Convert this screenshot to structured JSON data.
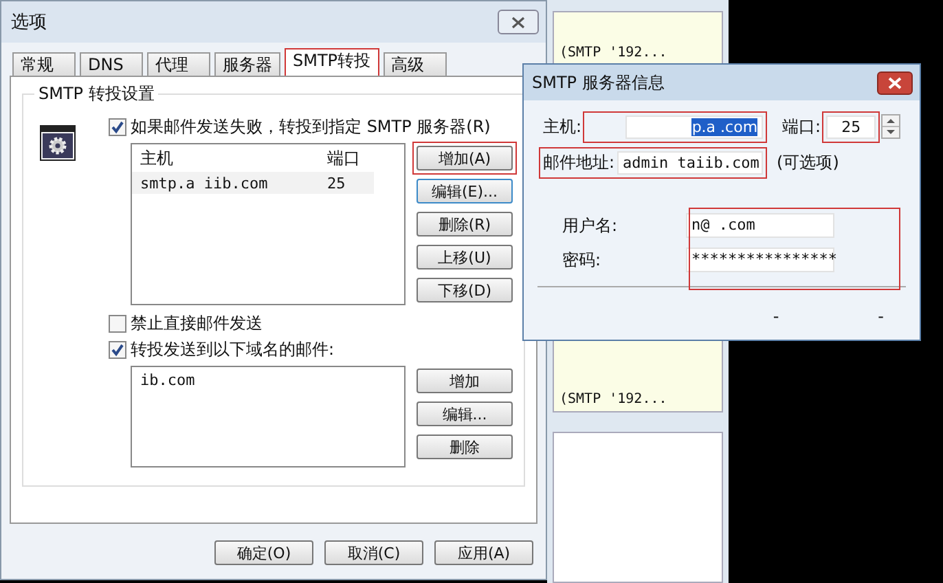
{
  "main_window": {
    "title": "选项",
    "tabs": [
      {
        "label": "常规",
        "selected": false,
        "highlighted": false
      },
      {
        "label": "DNS",
        "selected": false,
        "highlighted": false
      },
      {
        "label": "代理",
        "selected": false,
        "highlighted": false
      },
      {
        "label": "服务器",
        "selected": false,
        "highlighted": false
      },
      {
        "label": "SMTP转投",
        "selected": true,
        "highlighted": true
      },
      {
        "label": "高级",
        "selected": false,
        "highlighted": false
      }
    ],
    "group_title": "SMTP 转投设置",
    "relay_checkbox": {
      "label": "如果邮件发送失败，转投到指定 SMTP 服务器(R)",
      "checked": true
    },
    "server_table": {
      "columns": [
        "主机",
        "端口"
      ],
      "rows": [
        [
          "smtp.a iib.com",
          "25"
        ]
      ]
    },
    "server_buttons": [
      {
        "label": "增加(A)",
        "highlighted": true,
        "focused": false
      },
      {
        "label": "编辑(E)...",
        "highlighted": false,
        "focused": true
      },
      {
        "label": "删除(R)",
        "highlighted": false,
        "focused": false
      },
      {
        "label": "上移(U)",
        "highlighted": false,
        "focused": false
      },
      {
        "label": "下移(D)",
        "highlighted": false,
        "focused": false
      }
    ],
    "no_direct_checkbox": {
      "label": "禁止直接邮件发送",
      "checked": false
    },
    "domain_checkbox": {
      "label": "转投发送到以下域名的邮件:",
      "checked": true
    },
    "domains": [
      "ib.com"
    ],
    "domain_buttons": [
      "增加",
      "编辑...",
      "删除"
    ],
    "footer_buttons": [
      "确定(O)",
      "取消(C)",
      "应用(A)"
    ]
  },
  "background_window": {
    "items": [
      "(SMTP '192...",
      "(SMTP '192..."
    ]
  },
  "server_dialog": {
    "title": "SMTP 服务器信息",
    "host_label": "主机:",
    "host": {
      "value": "p.a .com",
      "selected": true,
      "highlighted": true
    },
    "port_label": "端口:",
    "port": {
      "value": "25",
      "highlighted": true
    },
    "email_label": "邮件地址:",
    "email": {
      "value": "admin taiib.com",
      "highlighted": true
    },
    "optional_note": "(可选项)",
    "credentials_highlighted": true,
    "username_label": "用户名:",
    "username": "n@ .com",
    "password_label": "密码:",
    "password": "****************",
    "footer_marks": [
      "-",
      "-"
    ]
  }
}
